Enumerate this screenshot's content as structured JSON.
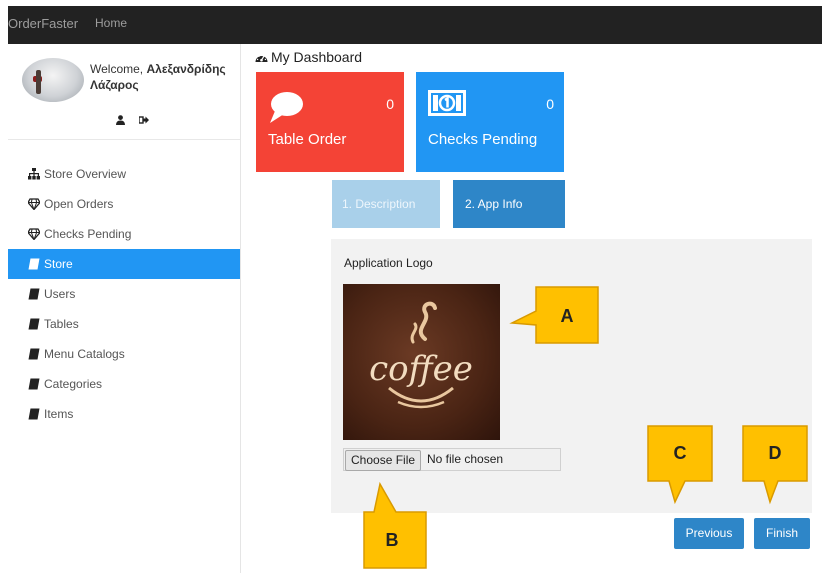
{
  "navbar": {
    "brand": "OrderFaster",
    "home": "Home"
  },
  "profile": {
    "welcome_prefix": "Welcome,",
    "name_line1": "Αλεξανδρίδης",
    "name_line2": "Λάζαρος",
    "icons": [
      "user-icon",
      "sign-out-icon"
    ]
  },
  "sidebar": {
    "items": [
      {
        "label": "Store Overview",
        "icon": "sitemap-icon",
        "active": false
      },
      {
        "label": "Open Orders",
        "icon": "diamond-icon",
        "active": false
      },
      {
        "label": "Checks Pending",
        "icon": "diamond-icon",
        "active": false
      },
      {
        "label": "Store",
        "icon": "book-icon",
        "active": true
      },
      {
        "label": "Users",
        "icon": "book-icon",
        "active": false
      },
      {
        "label": "Tables",
        "icon": "book-icon",
        "active": false
      },
      {
        "label": "Menu Catalogs",
        "icon": "book-icon",
        "active": false
      },
      {
        "label": "Categories",
        "icon": "book-icon",
        "active": false
      },
      {
        "label": "Items",
        "icon": "book-icon",
        "active": false
      }
    ]
  },
  "dashboard": {
    "title": "My Dashboard",
    "tiles": [
      {
        "label": "Table Order",
        "count": "0",
        "icon": "speech-bubble-icon",
        "color": "#f44336"
      },
      {
        "label": "Checks Pending",
        "count": "0",
        "icon": "money-icon",
        "color": "#2196f3"
      }
    ]
  },
  "wizard": {
    "steps": [
      "1. Description",
      "2. App Info"
    ],
    "active_step": 2
  },
  "app_info": {
    "logo_label": "Application Logo",
    "logo_text": "coffee",
    "file_button": "Choose File",
    "file_status": "No file chosen"
  },
  "actions": {
    "previous": "Previous",
    "finish": "Finish"
  },
  "callouts": {
    "a": "A",
    "b": "B",
    "c": "C",
    "d": "D"
  },
  "colors": {
    "red_tile": "#f44336",
    "blue_tile": "#2196f3",
    "active_menu": "#2196f3",
    "button": "#2e86c8",
    "callout": "#ffc000"
  }
}
